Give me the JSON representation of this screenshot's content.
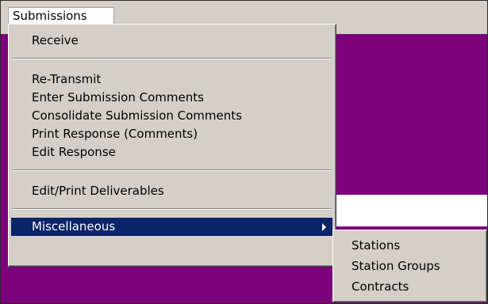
{
  "menubar": {
    "active_menu": "Submissions"
  },
  "menu": {
    "items": [
      {
        "label": "Receive"
      },
      {
        "label": "Re-Transmit"
      },
      {
        "label": "Enter Submission Comments"
      },
      {
        "label": "Consolidate Submission Comments"
      },
      {
        "label": "Print Response (Comments)"
      },
      {
        "label": "Edit Response"
      },
      {
        "label": "Edit/Print Deliverables"
      },
      {
        "label": "Miscellaneous"
      }
    ]
  },
  "submenu": {
    "items": [
      {
        "label": "Stations"
      },
      {
        "label": "Station Groups"
      },
      {
        "label": "Contracts"
      }
    ]
  },
  "colors": {
    "desktop": "#7c007c",
    "highlight": "#0a246a",
    "menu_face": "#d4d0c8"
  }
}
